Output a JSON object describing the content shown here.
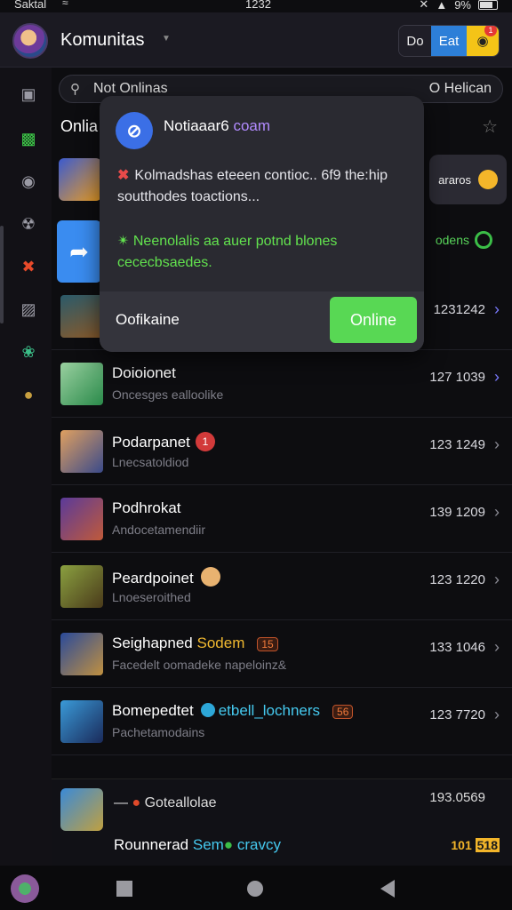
{
  "status_bar": {
    "carrier": "Saktal",
    "clock": "1232",
    "battery": "9%"
  },
  "header": {
    "title": "Komunitas",
    "btn_text": "Do",
    "btn_blue": "Eat",
    "notif_count": "1"
  },
  "search": {
    "placeholder": "Not Onlinas",
    "right_label": "O Helican"
  },
  "section_title": "Onlia",
  "under": {
    "tag1": "araros",
    "tag2": "odens"
  },
  "popup": {
    "title": "Notiaaar6",
    "title_accent": "coam",
    "warning": "Kolmadshas eteeen contioc.. 6f9 the:hip soutthodes toactions...",
    "success": "Neenolalis aa auer potnd blones cececbsaedes.",
    "status_label": "Oofikaine",
    "online_button": "Online"
  },
  "list": [
    {
      "name": "",
      "sub": "",
      "time": "1231242"
    },
    {
      "name": "Doioionet",
      "sub": "Oncesges ealloolike",
      "time": "127 1039"
    },
    {
      "name": "Podarpanet",
      "sub": "Lnecsatoldiod",
      "time": "123 1249",
      "badge": "1"
    },
    {
      "name": "Podhrokat",
      "sub": "Andocetamendiir",
      "time": "139 1209"
    },
    {
      "name": "Peardpoinet",
      "sub": "Lnoeseroithed",
      "time": "123 1220"
    },
    {
      "name": "Seighapned",
      "name_gold": "Sodem",
      "tag": "15",
      "sub": "Facedelt oomadeke napeloinz&",
      "time": "133 1046"
    },
    {
      "name": "Bomepedtet",
      "name_cyan": "etbell_lochners",
      "tag": "56",
      "sub": "Pachetamodains",
      "time": "123 7720"
    }
  ],
  "pinned": [
    {
      "name": "Goteallolae",
      "time": "193.0569"
    },
    {
      "name": "Rounnerad",
      "name_cyan": "Sem",
      "name_cyan2": "cravcy",
      "time": "101",
      "tag": "518"
    }
  ],
  "colors": {
    "accent": "#58d854",
    "blue": "#2d7fd8",
    "yellow": "#f4c417"
  }
}
